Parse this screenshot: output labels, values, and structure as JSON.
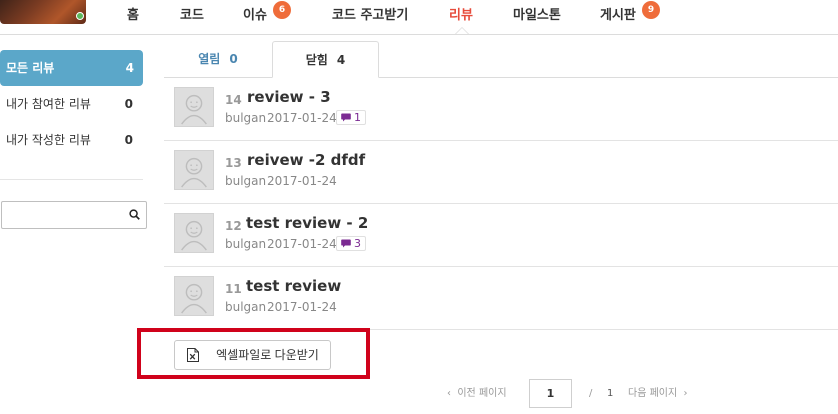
{
  "nav": {
    "items": [
      {
        "label": "홈"
      },
      {
        "label": "코드"
      },
      {
        "label": "이슈",
        "badge": "6"
      },
      {
        "label": "코드 주고받기"
      },
      {
        "label": "리뷰",
        "active": true
      },
      {
        "label": "마일스톤"
      },
      {
        "label": "게시판",
        "badge": "9"
      }
    ],
    "active_color": "#e74c3c",
    "badge_color": "#ef6c3a"
  },
  "sidebar": {
    "items": [
      {
        "label": "모든 리뷰",
        "count": "4",
        "active": true
      },
      {
        "label": "내가 참여한 리뷰",
        "count": "0"
      },
      {
        "label": "내가 작성한 리뷰",
        "count": "0"
      }
    ],
    "active_color": "#5ba7c9",
    "search": {
      "value": "",
      "placeholder": "",
      "icon": "search-icon"
    }
  },
  "tabs": [
    {
      "label": "열림",
      "count": "0"
    },
    {
      "label": "닫힘",
      "count": "4",
      "active": true
    }
  ],
  "reviews": [
    {
      "number": "14",
      "title": "review - 3",
      "author": "bulgan",
      "date": "2017-01-24",
      "comments": "1"
    },
    {
      "number": "13",
      "title": "reivew -2 dfdf",
      "author": "bulgan",
      "date": "2017-01-24",
      "comments": null
    },
    {
      "number": "12",
      "title": "test review - 2",
      "author": "bulgan",
      "date": "2017-01-24",
      "comments": "3"
    },
    {
      "number": "11",
      "title": "test review",
      "author": "bulgan",
      "date": "2017-01-24",
      "comments": null
    }
  ],
  "export": {
    "label": "엑셀파일로 다운받기",
    "icon": "excel-icon",
    "highlight_color": "#d0021b"
  },
  "pagination": {
    "prev_label": "이전 페이지",
    "current_page": "1",
    "separator": "/",
    "total_pages": "1",
    "next_label": "다음 페이지"
  }
}
